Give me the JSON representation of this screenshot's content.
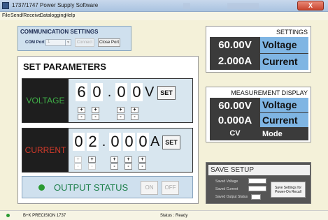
{
  "window": {
    "title": "1737/1747 Power Supply Software",
    "close_label": "X"
  },
  "menu": {
    "items": [
      "File",
      "Send/Receive",
      "Datalogging",
      "Help"
    ]
  },
  "comm": {
    "title": "COMMUNICATION SETTINGS",
    "com_port_label": "COM Port :",
    "com_port_value": "1",
    "connect_label": "Connect",
    "close_port_label": "Close Port"
  },
  "set_parameters": {
    "title": "SET PARAMETERS",
    "voltage": {
      "label": "VOLTAGE",
      "digits": [
        "6",
        "0",
        ".",
        "0",
        "0"
      ],
      "unit": "V",
      "set_label": "SET",
      "label_color": "#3fae47"
    },
    "current": {
      "label": "CURRENT",
      "digits": [
        "0",
        "2",
        ".",
        "0",
        "0",
        "0"
      ],
      "unit": "A",
      "set_label": "SET",
      "label_color": "#d23a2a"
    },
    "plus": "+",
    "minus": "-",
    "output_status_label": "OUTPUT STATUS",
    "on_label": "ON",
    "off_label": "OFF"
  },
  "settings": {
    "title": "SETTINGS",
    "voltage_value": "60.00V",
    "voltage_name": "Voltage",
    "current_value": "2.000A",
    "current_name": "Current"
  },
  "measurement": {
    "title": "MEASUREMENT DISPLAY",
    "voltage_value": "60.00V",
    "voltage_name": "Voltage",
    "current_value": "0.000A",
    "current_name": "Current",
    "mode_value": "CV",
    "mode_name": "Mode"
  },
  "save_setup": {
    "title": "SAVE SETUP",
    "saved_voltage": "Saved Voltage",
    "saved_current": "Saved Current",
    "saved_output_status": "Saved Output Status",
    "save_button": "Save Settings for Power-On Recall"
  },
  "statusbar": {
    "device": "B+K PRECISION 1737",
    "status": "Status : Ready"
  }
}
